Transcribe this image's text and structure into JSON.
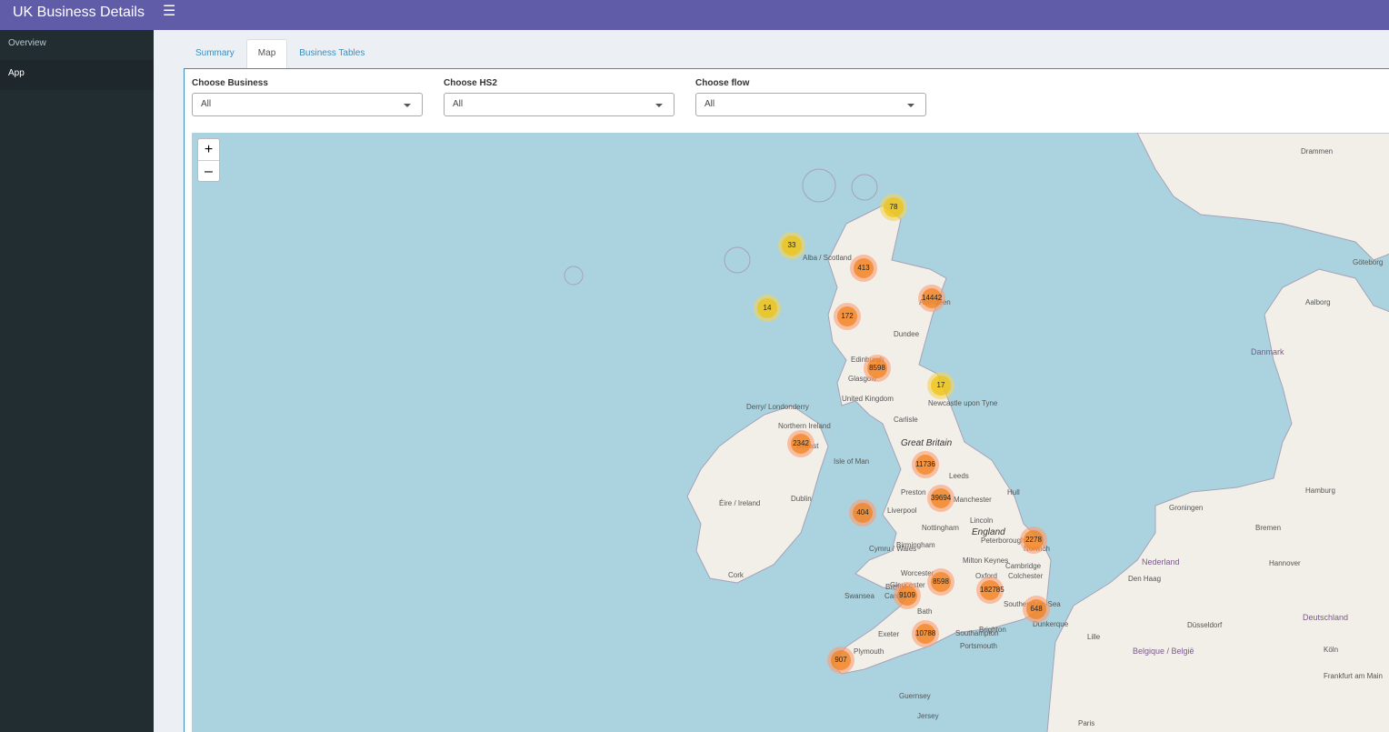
{
  "app": {
    "title": "UK Business Details"
  },
  "sidebar": {
    "items": [
      {
        "label": "Overview"
      },
      {
        "label": "App"
      }
    ]
  },
  "tabs": [
    {
      "label": "Summary"
    },
    {
      "label": "Map"
    },
    {
      "label": "Business Tables"
    }
  ],
  "filters": [
    {
      "label": "Choose Business",
      "value": "All"
    },
    {
      "label": "Choose HS2",
      "value": "All"
    },
    {
      "label": "Choose flow",
      "value": "All"
    }
  ],
  "map": {
    "zoom_in": "+",
    "zoom_out": "–",
    "clusters": [
      {
        "count": "78",
        "size": "small"
      },
      {
        "count": "33",
        "size": "small"
      },
      {
        "count": "413",
        "size": "medium"
      },
      {
        "count": "14442",
        "size": "medium"
      },
      {
        "count": "14",
        "size": "small"
      },
      {
        "count": "172",
        "size": "medium"
      },
      {
        "count": "8598",
        "size": "medium"
      },
      {
        "count": "17",
        "size": "small"
      },
      {
        "count": "2342",
        "size": "medium"
      },
      {
        "count": "11736",
        "size": "medium"
      },
      {
        "count": "39694",
        "size": "medium"
      },
      {
        "count": "404",
        "size": "medium"
      },
      {
        "count": "2278",
        "size": "medium"
      },
      {
        "count": "8598",
        "size": "medium"
      },
      {
        "count": "9109",
        "size": "medium"
      },
      {
        "count": "182785",
        "size": "medium"
      },
      {
        "count": "648",
        "size": "medium"
      },
      {
        "count": "10788",
        "size": "medium"
      },
      {
        "count": "907",
        "size": "medium"
      }
    ],
    "labels": [
      "Great Britain",
      "United Kingdom",
      "Glasgow",
      "Dundee",
      "Newcastle upon Tyne",
      "Carlisle",
      "Leeds",
      "Liverpool",
      "Manchester",
      "Nottingham",
      "Birmingham",
      "Peterborough",
      "Norwich",
      "Cambridge",
      "Colchester",
      "Swansea",
      "Bristol",
      "Bath",
      "Exeter",
      "Plymouth",
      "Portsmouth",
      "Brighton",
      "Southend-on-Sea",
      "Dunkerque",
      "Lille",
      "Isle of Man",
      "Dublin",
      "Éire / Ireland",
      "Cork",
      "Derry/ Londonderry",
      "Belfast",
      "Danmark",
      "Hamburg",
      "Bremen",
      "Groningen",
      "Hannover",
      "Nederland",
      "Den Haag",
      "Düsseldorf",
      "Deutschland",
      "Belgique / België",
      "Frankfurt am Main",
      "Paris",
      "Göteborg",
      "Aalborg",
      "Drammen",
      "Köln",
      "Guernsey",
      "Jersey",
      "Hull",
      "Lincoln",
      "Milton Keynes",
      "Oxford",
      "Gloucester",
      "Worcester",
      "Preston",
      "Cardiff",
      "Southampton",
      "Edinburgh",
      "Aberdeen",
      "Alba / Scotland",
      "England",
      "Cymru / Wales",
      "Northern Ireland"
    ]
  }
}
